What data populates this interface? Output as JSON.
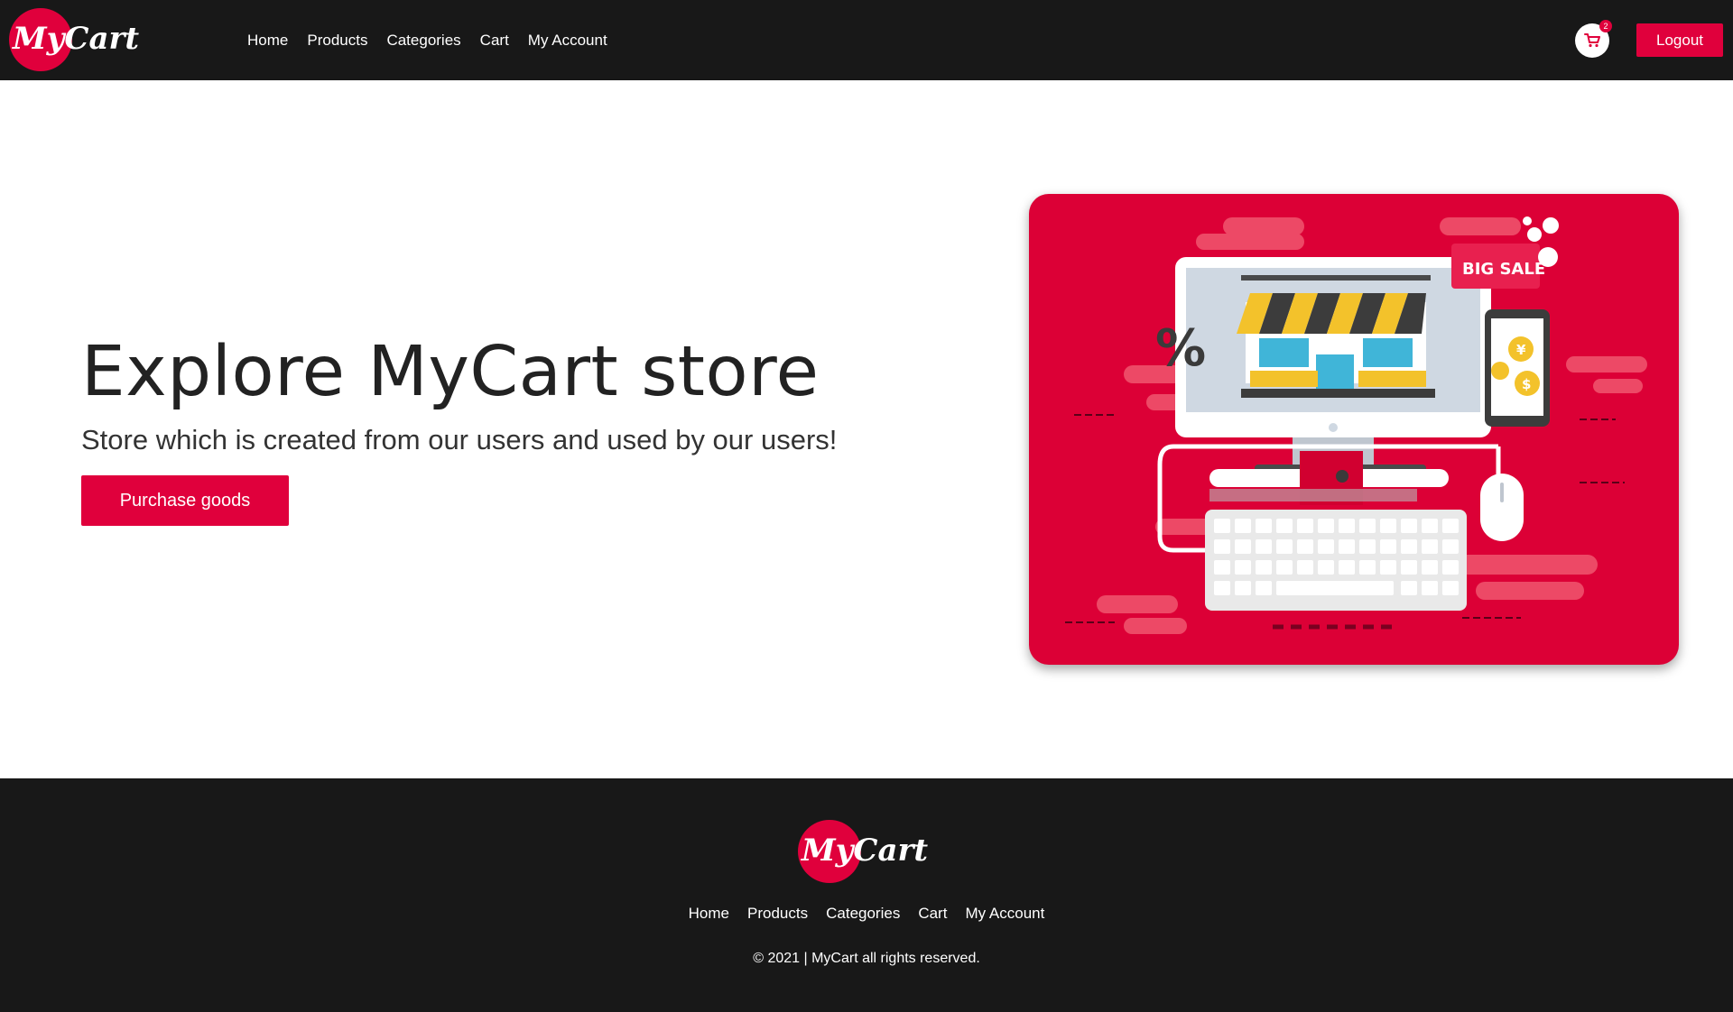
{
  "brand": {
    "name": "MyCart",
    "accent": "#e0003c",
    "dark": "#181818"
  },
  "header": {
    "nav": [
      "Home",
      "Products",
      "Categories",
      "Cart",
      "My Account"
    ],
    "cart_count": "2",
    "cart_icon": "shopping-cart-icon",
    "logout_label": "Logout"
  },
  "hero": {
    "title": "Explore MyCart store",
    "subtitle": "Store which is created from our users and used by our users!",
    "cta_label": "Purchase goods",
    "illustration_sale_text": "BIG SALE",
    "illustration_percent": "%"
  },
  "footer": {
    "nav": [
      "Home",
      "Products",
      "Categories",
      "Cart",
      "My Account"
    ],
    "copyright": "© 2021 | MyCart all rights reserved."
  }
}
